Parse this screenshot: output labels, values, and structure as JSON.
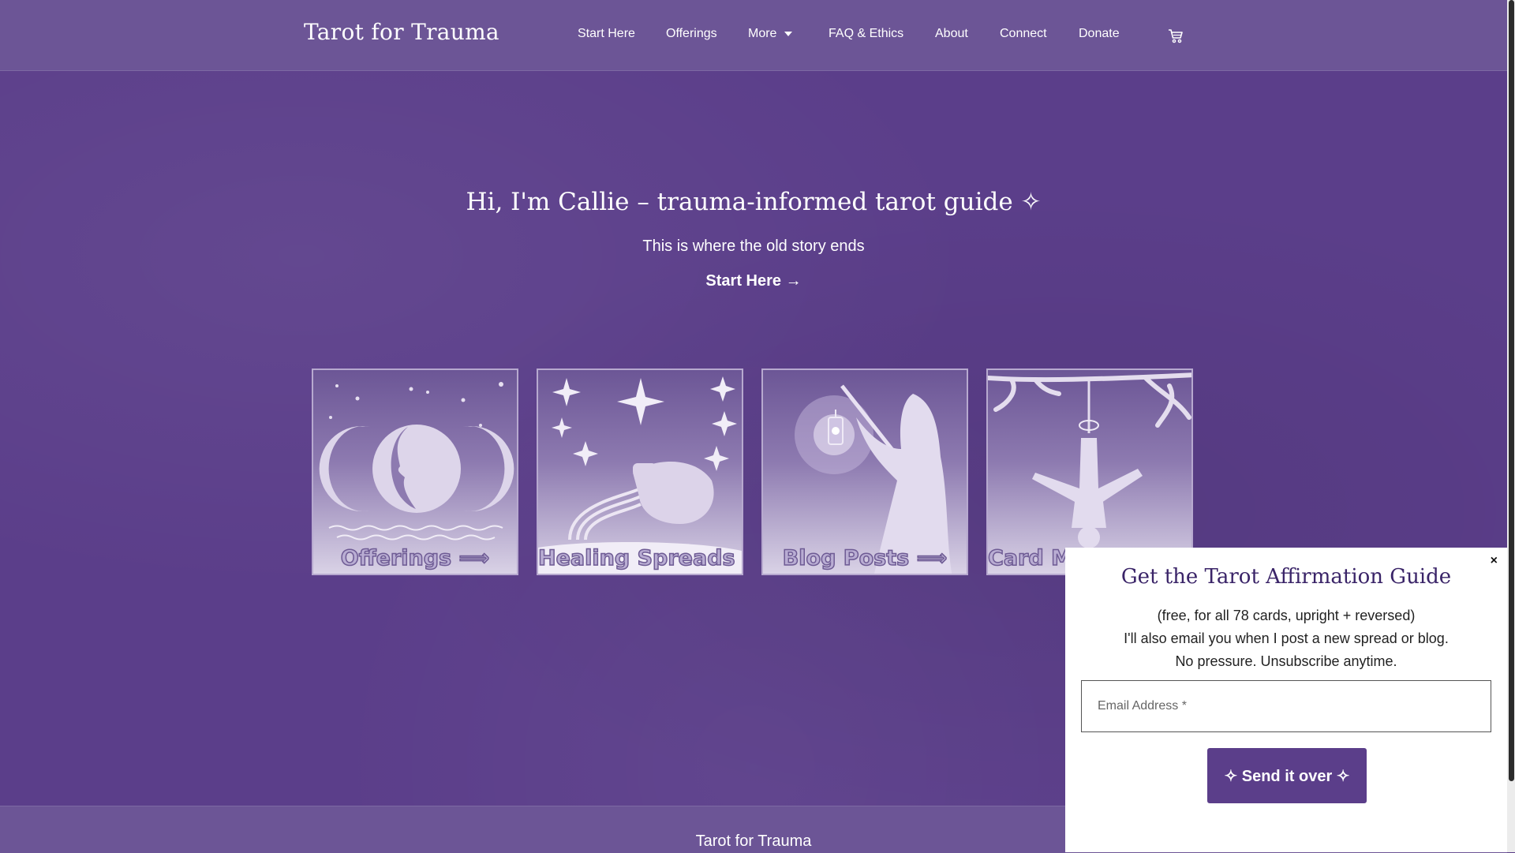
{
  "header": {
    "logo": "Tarot for Trauma",
    "nav": [
      "Start Here",
      "Offerings",
      "More",
      "FAQ & Ethics",
      "About",
      "Connect",
      "Donate"
    ],
    "cart_icon": "cart-icon"
  },
  "hero": {
    "title": "Hi, I'm Callie – trauma-informed tarot guide ✧",
    "subtitle": "This is where the old story ends",
    "cta": "Start Here →"
  },
  "tiles": [
    {
      "label": "Offerings ⟹",
      "image": "triple-moon-image"
    },
    {
      "label": "Healing Spreads ⟹",
      "image": "stars-water-jug-image"
    },
    {
      "label": "Blog Posts ⟹",
      "image": "hermit-lantern-image"
    },
    {
      "label": "Card Meanings ⟹",
      "image": "hanged-man-image"
    }
  ],
  "footer": {
    "text": "Tarot for Trauma"
  },
  "popup": {
    "close": "×",
    "title": "Get the Tarot Affirmation Guide",
    "line1": "(free, for all 78 cards, upright + reversed)",
    "line2": "I'll also email you when I post a new spread or blog.",
    "line3": "No pressure. Unsubscribe anytime.",
    "email_placeholder": "Email Address *",
    "email_value": "",
    "button": "✧ Send it over ✧"
  },
  "colors": {
    "background": "#5b3e8a",
    "header": "#6c5596",
    "popup_title": "#3a2468",
    "button": "#5b3e8a"
  }
}
